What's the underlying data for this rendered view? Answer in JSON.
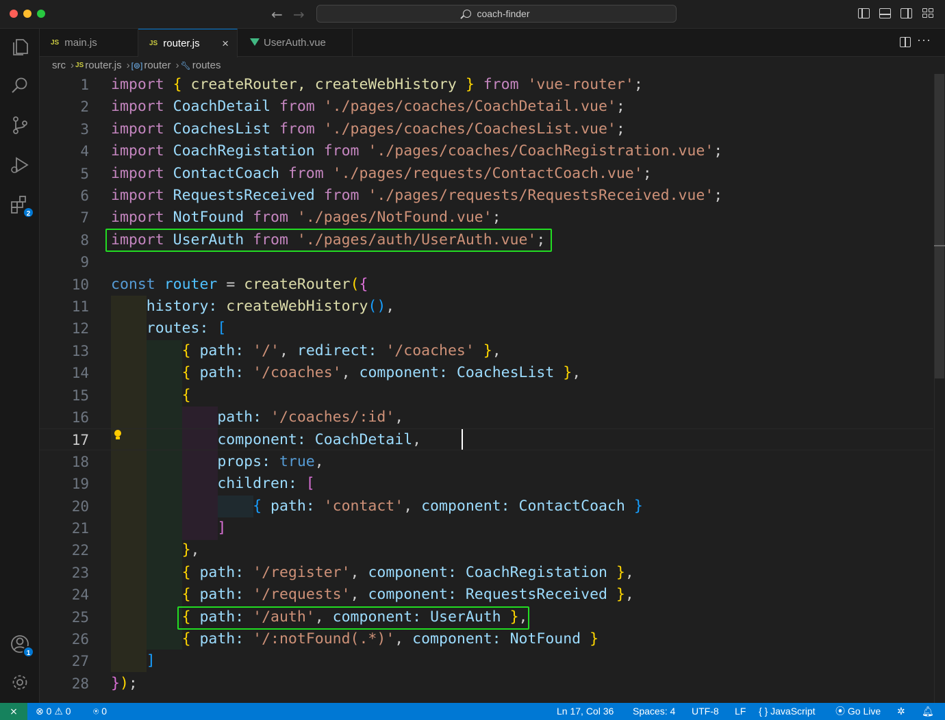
{
  "window": {
    "title": "coach-finder"
  },
  "tabs": [
    {
      "label": "main.js",
      "type": "JS"
    },
    {
      "label": "router.js",
      "type": "JS",
      "active": true
    },
    {
      "label": "UserAuth.vue",
      "type": "vue"
    }
  ],
  "tab_close": "×",
  "breadcrumb": {
    "folder": "src",
    "file": "router.js",
    "file_badge": "JS",
    "symbol1": "router",
    "symbol2": "routes"
  },
  "activity": {
    "extensions_badge": "2",
    "accounts_badge": "1"
  },
  "editor": {
    "active_line": 17,
    "line_numbers": [
      "1",
      "2",
      "3",
      "4",
      "5",
      "6",
      "7",
      "8",
      "9",
      "10",
      "11",
      "12",
      "13",
      "14",
      "15",
      "16",
      "17",
      "18",
      "19",
      "20",
      "21",
      "22",
      "23",
      "24",
      "25",
      "26",
      "27",
      "28"
    ]
  },
  "code": {
    "l1": [
      "import",
      "{",
      "createRouter,",
      "createWebHistory",
      "}",
      "from",
      "'vue-router'",
      ";"
    ],
    "l2": [
      "import",
      "CoachDetail",
      "from",
      "'./pages/coaches/CoachDetail.vue'",
      ";"
    ],
    "l3": [
      "import",
      "CoachesList",
      "from",
      "'./pages/coaches/CoachesList.vue'",
      ";"
    ],
    "l4": [
      "import",
      "CoachRegistation",
      "from",
      "'./pages/coaches/CoachRegistration.vue'",
      ";"
    ],
    "l5": [
      "import",
      "ContactCoach",
      "from",
      "'./pages/requests/ContactCoach.vue'",
      ";"
    ],
    "l6": [
      "import",
      "RequestsReceived",
      "from",
      "'./pages/requests/RequestsReceived.vue'",
      ";"
    ],
    "l7": [
      "import",
      "NotFound",
      "from",
      "'./pages/NotFound.vue'",
      ";"
    ],
    "l8": [
      "import",
      "UserAuth",
      "from",
      "'./pages/auth/UserAuth.vue'",
      ";"
    ],
    "l10": [
      "const",
      "router",
      "=",
      "createRouter",
      "(",
      "{"
    ],
    "l11": [
      "history:",
      "createWebHistory",
      "()",
      ","
    ],
    "l12": [
      "routes:",
      "["
    ],
    "l13": [
      "{",
      "path:",
      "'/'",
      ",",
      "redirect:",
      "'/coaches'",
      "}",
      ","
    ],
    "l14": [
      "{",
      "path:",
      "'/coaches'",
      ",",
      "component:",
      "CoachesList",
      "}",
      ","
    ],
    "l15": [
      "{"
    ],
    "l16": [
      "path:",
      "'/coaches/:id'",
      ","
    ],
    "l17": [
      "component:",
      "CoachDetail",
      ","
    ],
    "l18": [
      "props:",
      "true",
      ","
    ],
    "l19": [
      "children:",
      "["
    ],
    "l20": [
      "{",
      "path:",
      "'contact'",
      ",",
      "component:",
      "ContactCoach",
      "}"
    ],
    "l21": [
      "]"
    ],
    "l22": [
      "}",
      ","
    ],
    "l23": [
      "{",
      "path:",
      "'/register'",
      ",",
      "component:",
      "CoachRegistation",
      "}",
      ","
    ],
    "l24": [
      "{",
      "path:",
      "'/requests'",
      ",",
      "component:",
      "RequestsReceived",
      "}",
      ","
    ],
    "l25": [
      "{",
      "path:",
      "'/auth'",
      ",",
      "component:",
      "UserAuth",
      "}",
      ","
    ],
    "l26": [
      "{",
      "path:",
      "'/:notFound(.*)'",
      ",",
      "component:",
      "NotFound",
      "}"
    ],
    "l27": [
      "]"
    ],
    "l28": [
      "}",
      ")",
      ";"
    ]
  },
  "status": {
    "remote_icon": "remote-icon",
    "errors": "0",
    "warnings": "0",
    "ports": "0",
    "position": "Ln 17, Col 36",
    "spaces": "Spaces: 4",
    "encoding": "UTF-8",
    "eol": "LF",
    "language": "JavaScript",
    "go_live": "Go Live"
  },
  "colors": {
    "statusbar": "#0078d4",
    "highlight_box": "#22dd22",
    "accent": "#0078d4"
  }
}
